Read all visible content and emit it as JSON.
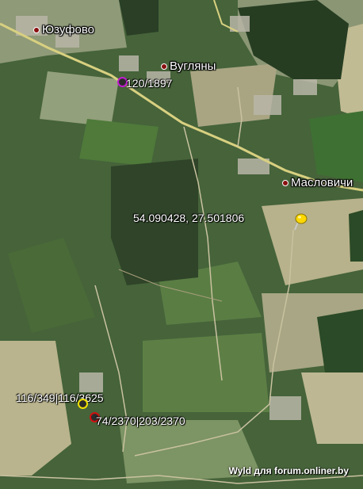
{
  "places": [
    {
      "id": "yuzufovo",
      "label": "Юзуфово"
    },
    {
      "id": "vuglyany",
      "label": "Вугляны"
    },
    {
      "id": "maslovichi",
      "label": "Масловичи"
    }
  ],
  "pin": {
    "label": "54.090428, 27.501806",
    "color": "#ffd800"
  },
  "markers": [
    {
      "id": "magenta",
      "label": "120/1897",
      "color": "#c21bd1"
    },
    {
      "id": "yellow",
      "label": "116/349|116/3625",
      "color": "#f0e000"
    },
    {
      "id": "red",
      "label": "74/2370|203/2370",
      "color": "#d01010"
    }
  ],
  "watermark": "Wyld для forum.onliner.by",
  "colors": {
    "road_main": "#d8d080",
    "road_minor": "#c9c2a0",
    "farmland_light": "#b9b48d",
    "field_green": "#4f7a3a",
    "forest_dark": "#263d22"
  }
}
